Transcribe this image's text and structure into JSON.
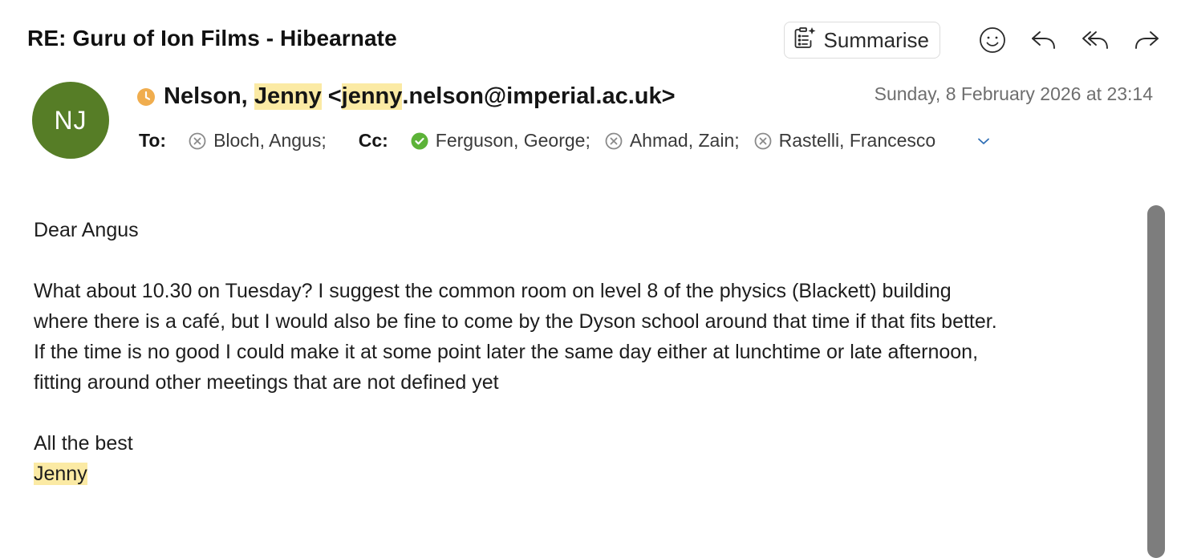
{
  "email": {
    "subject": "RE: Guru of Ion Films - Hibearnate",
    "sender": {
      "initials": "NJ",
      "avatar_color": "#567d26",
      "name_prefix": "Nelson, ",
      "name_highlight": "Jenny",
      "email_open": " <",
      "email_highlight": "jenny",
      "email_rest": ".nelson@imperial.ac.uk>",
      "presence_icon": "clock-icon",
      "presence_color": "#f0ad4e"
    },
    "date": "Sunday, 8 February 2026 at 23:14",
    "to_label": "To:",
    "cc_label": "Cc:",
    "to": [
      {
        "name": "Bloch, Angus;",
        "status": "unavailable"
      }
    ],
    "cc": [
      {
        "name": "Ferguson, George;",
        "status": "available"
      },
      {
        "name": "Ahmad, Zain;",
        "status": "unavailable"
      },
      {
        "name": "Rastelli, Francesco",
        "status": "unavailable"
      }
    ],
    "body": {
      "greeting": "Dear Angus",
      "para1_line1": "What about 10.30 on Tuesday? I suggest the common room on level 8 of the physics (Blackett) building",
      "para1_line2": "where there is a café, but I would also be fine to come by the Dyson school around that time if that fits better.",
      "para1_line3": "If the time is no good I could make it at some point later the same day either at lunchtime or late afternoon,",
      "para1_line4": "fitting around other meetings that are not defined yet",
      "signoff": "All the best",
      "signature": "Jenny"
    }
  },
  "toolbar": {
    "summarise_label": "Summarise",
    "icons": [
      "summarise-icon",
      "emoji-icon",
      "reply-icon",
      "reply-all-icon",
      "forward-icon"
    ]
  },
  "colors": {
    "highlight": "#fbeaa4",
    "available": "#5cb338",
    "unavailable": "#8a8a8a",
    "expand_chevron": "#2f6fb5"
  }
}
